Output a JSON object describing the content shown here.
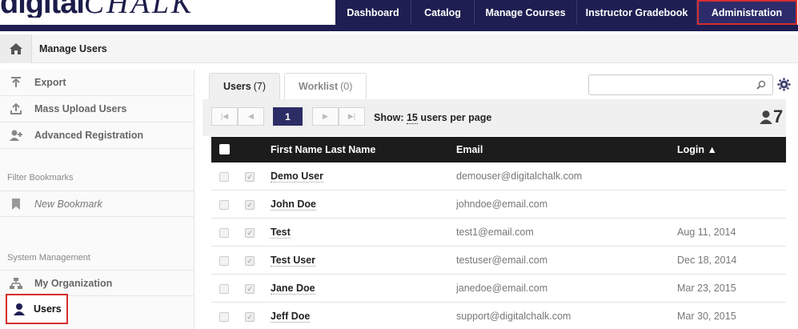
{
  "logo": {
    "part1": "digital",
    "part2": "CHALK"
  },
  "nav": [
    {
      "label": "Dashboard"
    },
    {
      "label": "Catalog"
    },
    {
      "label": "Manage Courses"
    },
    {
      "label": "Instructor Gradebook"
    },
    {
      "label": "Administration",
      "active": true
    }
  ],
  "breadcrumb": {
    "title": "Manage Users"
  },
  "sidebar": {
    "items": [
      {
        "label": "Export",
        "icon": "export-icon"
      },
      {
        "label": "Mass Upload Users",
        "icon": "upload-icon"
      },
      {
        "label": "Advanced Registration",
        "icon": "user-plus-icon"
      }
    ],
    "filter_section": "Filter Bookmarks",
    "bookmark": "New Bookmark",
    "system_section": "System Management",
    "organization": "My Organization",
    "users": "Users"
  },
  "tabs": [
    {
      "label": "Users",
      "count": "(7)",
      "active": true
    },
    {
      "label": "Worklist",
      "count": "(0)"
    }
  ],
  "search": {
    "value": "",
    "placeholder": ""
  },
  "pagination": {
    "current_page": "1",
    "show_prefix": "Show:",
    "per_page": "15",
    "show_suffix": "users per page"
  },
  "total_users": "7",
  "table": {
    "columns": {
      "name": "First Name Last Name",
      "email": "Email",
      "login": "Login ▲"
    },
    "rows": [
      {
        "name": "Demo User",
        "email": "demouser@digitalchalk.com",
        "login": ""
      },
      {
        "name": "John Doe",
        "email": "johndoe@email.com",
        "login": ""
      },
      {
        "name": "Test",
        "email": "test1@email.com",
        "login": "Aug 11, 2014"
      },
      {
        "name": "Test User",
        "email": "testuser@email.com",
        "login": "Dec 18, 2014"
      },
      {
        "name": "Jane Doe",
        "email": "janedoe@email.com",
        "login": "Mar 23, 2015"
      },
      {
        "name": "Jeff Doe",
        "email": "support@digitalchalk.com",
        "login": "Mar 30, 2015"
      }
    ]
  },
  "colors": {
    "nav_bg": "#1e1e52",
    "highlight": "#d62e2e",
    "page_btn": "#2d2d66",
    "header_row": "#1c1c1c"
  }
}
